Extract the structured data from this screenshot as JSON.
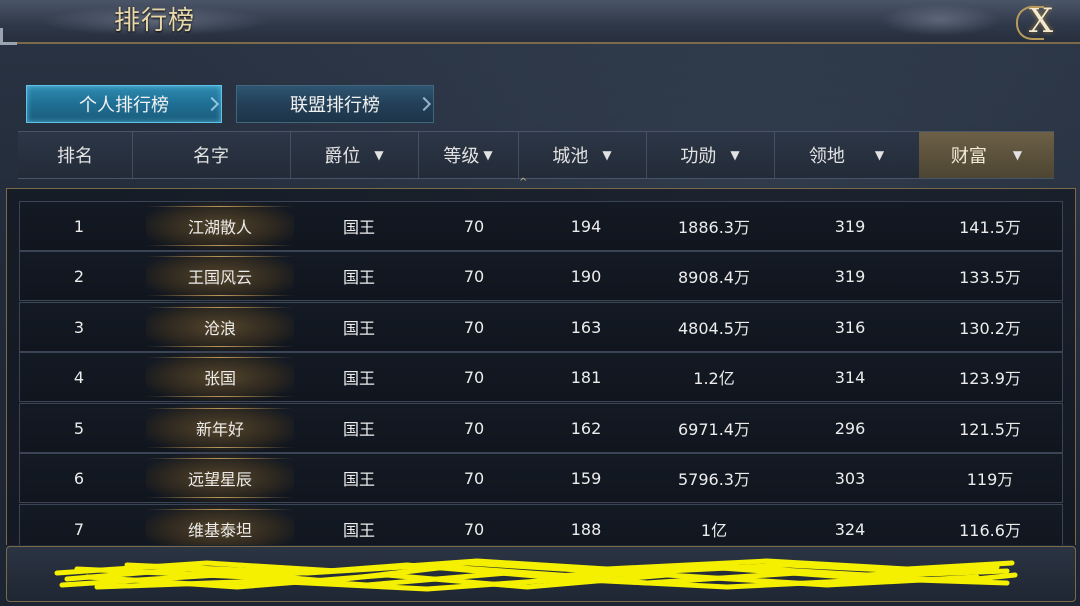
{
  "window": {
    "title": "排行榜",
    "close_label": "X"
  },
  "tabs": [
    {
      "label": "个人排行榜",
      "active": true
    },
    {
      "label": "联盟排行榜",
      "active": false
    }
  ],
  "columns": [
    {
      "label": "排名",
      "sortable": false
    },
    {
      "label": "名字",
      "sortable": false
    },
    {
      "label": "爵位",
      "sortable": true
    },
    {
      "label": "等级",
      "sortable": true
    },
    {
      "label": "城池",
      "sortable": true
    },
    {
      "label": "功勋",
      "sortable": true
    },
    {
      "label": "领地",
      "sortable": true
    },
    {
      "label": "财富",
      "sortable": true,
      "active": true
    }
  ],
  "sort_arrow": "▼",
  "rows": [
    {
      "rank": "1",
      "name": "江湖散人",
      "title": "国王",
      "level": "70",
      "cities": "194",
      "merit": "1886.3万",
      "territory": "319",
      "wealth": "141.5万"
    },
    {
      "rank": "2",
      "name": "王国风云",
      "title": "国王",
      "level": "70",
      "cities": "190",
      "merit": "8908.4万",
      "territory": "319",
      "wealth": "133.5万"
    },
    {
      "rank": "3",
      "name": "沧浪",
      "title": "国王",
      "level": "70",
      "cities": "163",
      "merit": "4804.5万",
      "territory": "316",
      "wealth": "130.2万"
    },
    {
      "rank": "4",
      "name": "张国",
      "title": "国王",
      "level": "70",
      "cities": "181",
      "merit": "1.2亿",
      "territory": "314",
      "wealth": "123.9万"
    },
    {
      "rank": "5",
      "name": "新年好",
      "title": "国王",
      "level": "70",
      "cities": "162",
      "merit": "6971.4万",
      "territory": "296",
      "wealth": "121.5万"
    },
    {
      "rank": "6",
      "name": "远望星辰",
      "title": "国王",
      "level": "70",
      "cities": "159",
      "merit": "5796.3万",
      "territory": "303",
      "wealth": "119万"
    },
    {
      "rank": "7",
      "name": "维基泰坦",
      "title": "国王",
      "level": "70",
      "cities": "188",
      "merit": "1亿",
      "territory": "324",
      "wealth": "116.6万"
    }
  ],
  "colors": {
    "title_gold": "#e8d7a8",
    "active_tab": "#1f6f94",
    "active_column": "#6c6046",
    "redaction_yellow": "#f4f000"
  }
}
